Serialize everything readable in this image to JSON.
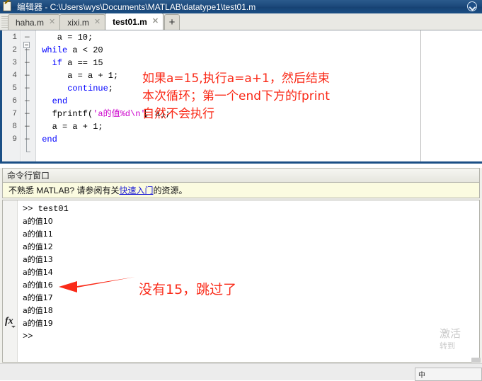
{
  "titlebar": {
    "app_name": "编辑器",
    "separator": " - ",
    "path": "C:\\Users\\wys\\Documents\\MATLAB\\datatype1\\test01.m",
    "full": "编辑器 - C:\\Users\\wys\\Documents\\MATLAB\\datatype1\\test01.m",
    "icon": "editor-notepad-pencil-icon",
    "dropdown_icon": "circle-chevron-down-icon"
  },
  "tabs": {
    "items": [
      {
        "label": "haha.m",
        "close": "✕",
        "active": false
      },
      {
        "label": "xixi.m",
        "close": "✕",
        "active": false
      },
      {
        "label": "test01.m",
        "close": "✕",
        "active": true
      }
    ],
    "add_label": "+"
  },
  "editor": {
    "line_numbers": [
      "1",
      "2",
      "3",
      "4",
      "5",
      "6",
      "7",
      "8",
      "9"
    ],
    "breakpoint_marks": [
      "—",
      "—",
      "—",
      "—",
      "—",
      "—",
      "—",
      "—",
      "—"
    ],
    "lines": [
      {
        "indent": 4,
        "segments": [
          {
            "t": "a = 10;",
            "c": "plain"
          }
        ]
      },
      {
        "indent": 1,
        "segments": [
          {
            "t": "while",
            "c": "kw"
          },
          {
            "t": " a < 20",
            "c": "plain"
          }
        ]
      },
      {
        "indent": 3,
        "segments": [
          {
            "t": "if",
            "c": "kw"
          },
          {
            "t": " a == 15",
            "c": "plain"
          }
        ]
      },
      {
        "indent": 6,
        "segments": [
          {
            "t": "a = a + 1;",
            "c": "plain"
          }
        ]
      },
      {
        "indent": 6,
        "segments": [
          {
            "t": "continue",
            "c": "kw"
          },
          {
            "t": ";",
            "c": "plain"
          }
        ]
      },
      {
        "indent": 3,
        "segments": [
          {
            "t": "end",
            "c": "kw"
          }
        ]
      },
      {
        "indent": 3,
        "segments": [
          {
            "t": "fprintf(",
            "c": "plain"
          },
          {
            "t": "'a的值%d\\n'",
            "c": "str"
          },
          {
            "t": "|",
            "c": "caret"
          },
          {
            "t": ", a);",
            "c": "plain"
          }
        ]
      },
      {
        "indent": 3,
        "segments": [
          {
            "t": "a = a + 1;",
            "c": "plain"
          }
        ]
      },
      {
        "indent": 1,
        "segments": [
          {
            "t": "end",
            "c": "kw"
          }
        ]
      }
    ],
    "annotation": "如果a=15,执行a=a+1，然后结束\n本次循环；第一个end下方的fprint\n自然不会执行",
    "annotation_color": "#fa2a18",
    "keyword_color": "#0000ff",
    "string_color": "#cc00cc"
  },
  "command_window": {
    "title": "命令行窗口",
    "banner_prefix": "不熟悉 MATLAB? 请参阅有关",
    "banner_link": "快速入门",
    "banner_suffix": "的资源。",
    "link_color": "#1a1ad6",
    "lines": [
      ">> test01",
      "a的值10",
      "a的值11",
      "a的值12",
      "a的值13",
      "a的值14",
      "a的值16",
      "a的值17",
      "a的值18",
      "a的值19"
    ],
    "prompt_icon": "fx-function-icon",
    "prompt": ">>",
    "annotation": "没有15，跳过了",
    "annotation_color": "#fa2a18",
    "arrow_icon": "red-left-arrow-icon"
  },
  "watermark": {
    "line1": "激活",
    "line2": "转到"
  },
  "bottom": {
    "ime_label": "中"
  }
}
